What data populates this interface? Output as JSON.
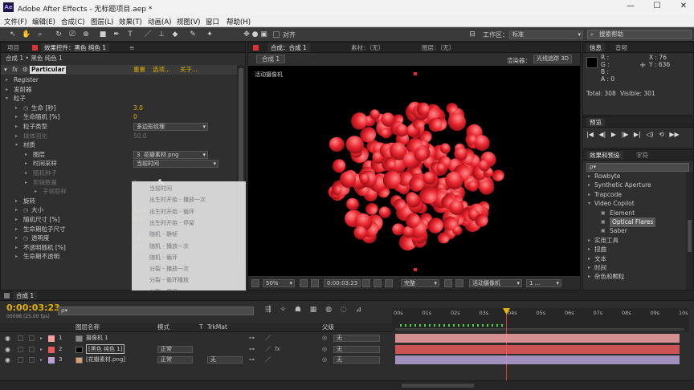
{
  "window": {
    "title": "Adobe After Effects - 无标题项目.aep *",
    "app_icon": "Ae"
  },
  "menu": [
    "文件(F)",
    "编辑(E)",
    "合成(C)",
    "图层(L)",
    "效果(T)",
    "动画(A)",
    "视图(V)",
    "窗口",
    "帮助(H)"
  ],
  "toolbar": {
    "snap_label": "对齐",
    "workspace_label": "工作区：",
    "workspace_value": "标准",
    "search_placeholder": "搜索帮助"
  },
  "left_panel": {
    "tabs": [
      "项目",
      "效果控件：黑色 纯色 1",
      "≡"
    ],
    "breadcrumb": "合成 1 • 黑色 纯色 1",
    "effect": {
      "fx": "fx",
      "name": "Particular",
      "reset": "重置",
      "options": "选项...",
      "about": "关于..."
    },
    "rows": [
      {
        "label": "Register",
        "indent": 1
      },
      {
        "label": "发射器",
        "indent": 1
      },
      {
        "label": "粒子",
        "indent": 1
      },
      {
        "label": "生命 [秒]",
        "indent": 2,
        "stopwatch": true,
        "value": "3.0"
      },
      {
        "label": "生命随机 [%]",
        "indent": 2,
        "value": "0"
      },
      {
        "label": "粒子类型",
        "indent": 2,
        "dropdown": "多边形纹理"
      },
      {
        "label": "球体羽化",
        "indent": 2,
        "value": "50.0",
        "dim": true
      },
      {
        "label": "材质",
        "indent": 2
      },
      {
        "label": "图层",
        "indent": 3,
        "dropdown": "3. 花瓣素材.png"
      },
      {
        "label": "时间采样",
        "indent": 3,
        "dropdown": "当前时间"
      },
      {
        "label": "随机种子",
        "indent": 3,
        "dim": true
      },
      {
        "label": "剪辑数量",
        "indent": 3,
        "dim": true,
        "value": "2"
      },
      {
        "label": "子帧取样",
        "indent": 4,
        "dim": true
      },
      {
        "label": "旋转",
        "indent": 2
      },
      {
        "label": "大小",
        "indent": 2,
        "stopwatch": true,
        "value": "32.0"
      },
      {
        "label": "随机尺寸 [%]",
        "indent": 2,
        "value": "0.0"
      },
      {
        "label": "生命期粒子尺寸",
        "indent": 2
      },
      {
        "label": "透明度",
        "indent": 2,
        "stopwatch": true,
        "value": "100.0"
      },
      {
        "label": "不透明随机 [%]",
        "indent": 2,
        "value": "0.0"
      },
      {
        "label": "生命期不透明",
        "indent": 2
      }
    ]
  },
  "dropdown_menu": [
    "当前时间",
    "出生时开始 - 播放一次",
    "出生时开始 - 循环",
    "出生时开始 - 停留",
    "随机 - 静帧",
    "随机 - 播放一次",
    "随机 - 循环",
    "分裂 - 播放一次",
    "分裂 - 循环播放",
    "分裂 - 停留",
    "分裂 - 静帧"
  ],
  "comp_panel": {
    "tabs": [
      "合成：合成 1",
      "素材：（无）",
      "图层：（无）"
    ],
    "comp_tab": "合成 1",
    "renderer": "渲染器：",
    "renderer_value": "光线追踪 3D",
    "camera_label": "活动摄像机",
    "zoom": "50%",
    "timecode": "0:00:03:23",
    "quality": "完整",
    "view": "活动摄像机",
    "views": "1 ..."
  },
  "info_panel": {
    "tabs": [
      "信息",
      "音频"
    ],
    "r": "R :",
    "g": "G :",
    "b": "B :",
    "a": "A : 0",
    "x": "X : 76",
    "y": "Y : 636",
    "total": "Total: 308",
    "visible": "Visible: 301"
  },
  "preview_panel": {
    "tab": "预览"
  },
  "effects_panel": {
    "tabs": [
      "效果和预设",
      "字符"
    ],
    "search_placeholder": "ρ▾",
    "items": [
      {
        "label": "Rowbyte",
        "indent": 1
      },
      {
        "label": "Synthetic Aperture",
        "indent": 1
      },
      {
        "label": "Trapcode",
        "indent": 1
      },
      {
        "label": "Video Copilot",
        "indent": 1,
        "open": true
      },
      {
        "label": "Element",
        "indent": 2
      },
      {
        "label": "Optical Flares",
        "indent": 2,
        "selected": true
      },
      {
        "label": "Saber",
        "indent": 2
      },
      {
        "label": "实用工具",
        "indent": 1
      },
      {
        "label": "扭曲",
        "indent": 1
      },
      {
        "label": "文本",
        "indent": 1
      },
      {
        "label": "时间",
        "indent": 1
      },
      {
        "label": "杂色和颗粒",
        "indent": 1
      }
    ]
  },
  "timeline": {
    "tab": "合成 1",
    "timecode": "0:00:03:23",
    "frame_info": "00098 (25.00 fps)",
    "search_placeholder": "ρ▾",
    "columns": {
      "layer_name": "图层名称",
      "mode": "模式",
      "t": "T",
      "trkmat": "TrkMat",
      "parent": "父级"
    },
    "ruler": [
      "00s",
      "01s",
      "02s",
      "03s",
      "04s",
      "05s",
      "06s",
      "07s",
      "08s",
      "09s",
      "10s"
    ],
    "layers": [
      {
        "num": "1",
        "name": "摄像机 1",
        "mode": "",
        "trkmat": "",
        "parent": "无",
        "color": "#f2a2a2"
      },
      {
        "num": "2",
        "name": "[黑色 纯色 1]",
        "mode": "正常",
        "trkmat": "",
        "parent": "无",
        "color": "#e85a5a"
      },
      {
        "num": "3",
        "name": "[花瓣素材.png]",
        "mode": "正常",
        "trkmat": "无",
        "parent": "无",
        "color": "#b7a3d8"
      }
    ]
  }
}
